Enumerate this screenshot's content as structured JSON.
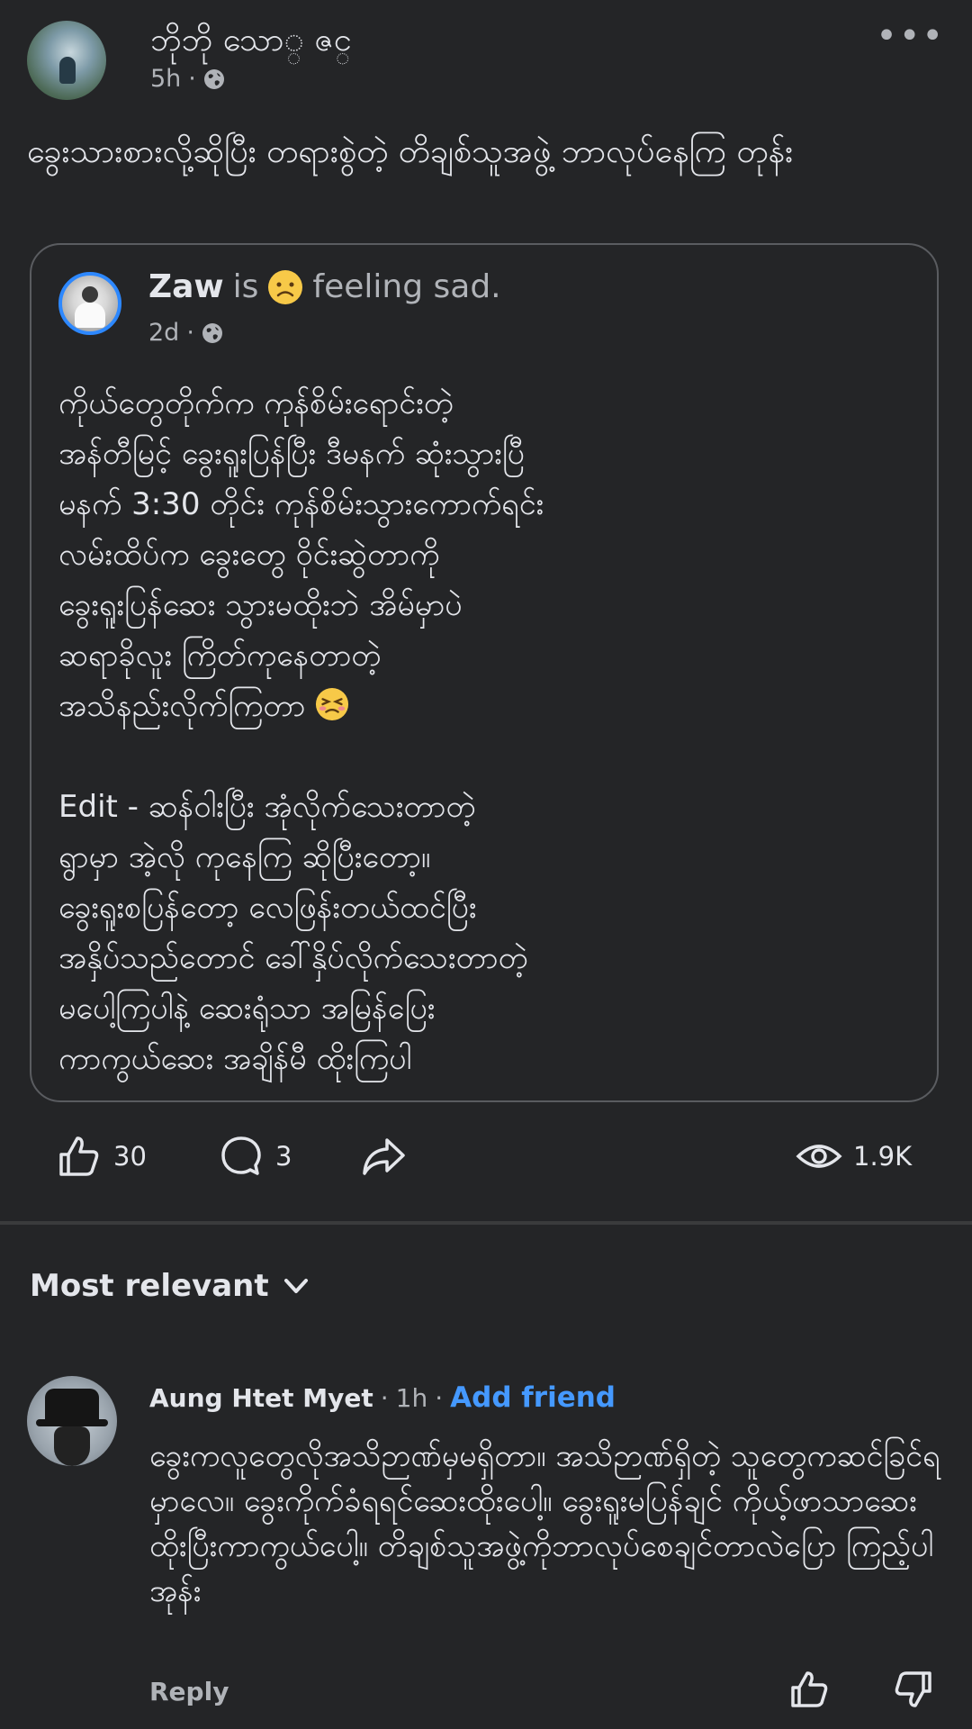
{
  "post": {
    "author": "ဘိုဘို သော္ ဇင္",
    "time": "5h",
    "text": "ခွေးသားစားလို့ဆိုပြီး တရားစွဲတဲ့ တိချစ်သူအဖွဲ့ ဘာလုပ်နေကြ တုန်း",
    "privacy_icon": "globe-icon",
    "more_icon": "more-icon"
  },
  "shared_post": {
    "author": "Zaw",
    "is_label": "is",
    "feeling": "feeling sad.",
    "feeling_icon": "sad-face-icon",
    "time": "2d",
    "lines": [
      "ကိုယ်တွေတိုက်က ကုန်စိမ်းရောင်းတဲ့",
      "အန်တီမြင့် ခွေးရူးပြန်ပြီး ဒီမနက် ဆုံးသွားပြီ",
      "မနက် 3:30 တိုင်း ကုန်စိမ်းသွားကောက်ရင်း",
      "လမ်းထိပ်က ခွေးတွေ ဝိုင်းဆွဲတာကို",
      "ခွေးရူးပြန်ဆေး သွားမထိုးဘဲ အိမ်မှာပဲ",
      "ဆရာခိုလူး ကြိတ်ကုနေတာတဲ့",
      "အသိနည်းလိုက်ကြတာ"
    ],
    "lines_emoji_icon": "persevering-face-icon",
    "edit_lines": [
      "Edit - ဆန်ဝါးပြီး အုံလိုက်သေးတာတဲ့",
      "ရွာမှာ အဲ့လို ကုနေကြ ဆိုပြီးတော့။",
      "ခွေးရူးစပြန်တော့ လေဖြန်းတယ်ထင်ပြီး",
      "အနှိပ်သည်တောင် ခေါ်နှိပ်လိုက်သေးတာတဲ့",
      "မပေါ့ကြပါနဲ့ ဆေးရုံသာ အမြန်ပြေး",
      "ကာကွယ်ဆေး အချိန်မီ ထိုးကြပါ"
    ]
  },
  "actions": {
    "likes": "30",
    "comments": "3",
    "views": "1.9K",
    "like_icon": "like-icon",
    "comment_icon": "comment-icon",
    "share_icon": "share-icon",
    "views_icon": "eye-icon"
  },
  "comments": {
    "sort_label": "Most relevant",
    "items": [
      {
        "author": "Aung Htet Myet",
        "time": "1h",
        "add_friend": "Add friend",
        "text": "ခွေးကလူတွေလိုအသိဉာဏ်မှမရှိတာ။ အသိဉာဏ်ရှိတဲ့ သူတွေကဆင်ခြင်ရမှာလေ။ ခွေးကိုက်ခံရရင်ဆေးထိုးပေါ့။ ခွေးရူးမပြန်ချင် ကိုယ့်ဖာသာဆေးထိုးပြီးကာကွယ်ပေါ့။ တိချစ်သူအဖွဲ့ကိုဘာလုပ်စေချင်တာလဲပြော ကြည့်ပါအုန်း",
        "reply": "Reply"
      }
    ]
  }
}
